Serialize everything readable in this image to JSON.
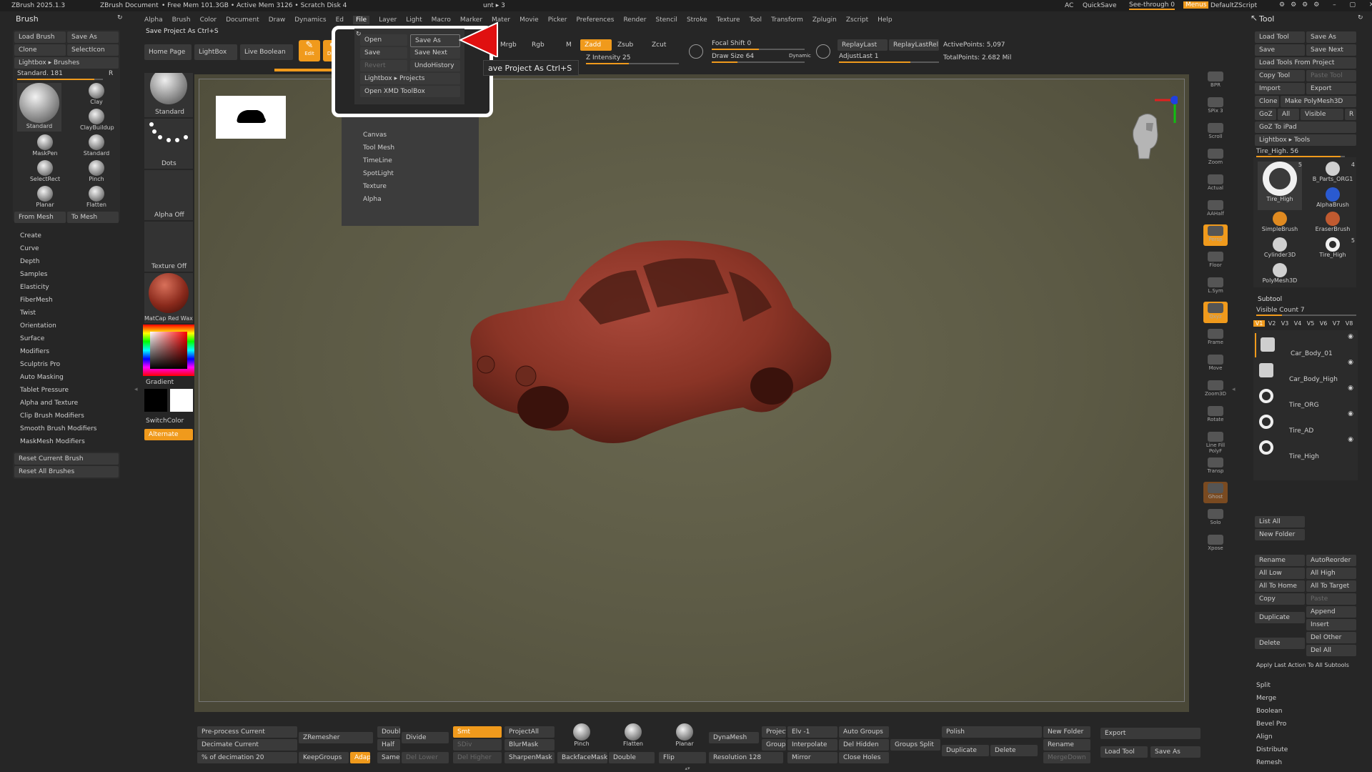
{
  "titlebar": {
    "app": "ZBrush 2025.1.3",
    "doc": "ZBrush Document",
    "mem": "• Free Mem 101.3GB • Active Mem 3126 • Scratch Disk 4",
    "tail": "unt ▸ 3",
    "ac": "AC",
    "quicksave": "QuickSave",
    "seethrough": "See-through 0",
    "menus": "Menus",
    "script": "DefaultZScript"
  },
  "menubar": [
    "Alpha",
    "Brush",
    "Color",
    "Document",
    "Draw",
    "Dynamics",
    "Ed",
    "File",
    "Layer",
    "Light",
    "Macro",
    "Marker",
    "Mater",
    "Movie",
    "Picker",
    "Preferences",
    "Render",
    "Stencil",
    "Stroke",
    "Texture",
    "Tool",
    "Transform",
    "Zplugin",
    "Zscript",
    "Help"
  ],
  "file_menu": {
    "open": "Open",
    "save_as": "Save As",
    "save": "Save",
    "save_next": "Save Next",
    "revert": "Revert",
    "undo_history": "UndoHistory",
    "lightbox_projects": "Lightbox ▸ Projects",
    "open_xmd": "Open XMD ToolBox",
    "sub": [
      "Canvas",
      "Tool Mesh",
      "TimeLine",
      "SpotLight",
      "Texture",
      "Alpha"
    ]
  },
  "tooltip": "ave Project As  Ctrl+S",
  "hint": "Save Project As Ctrl+S",
  "brush_palette": {
    "title": "Brush",
    "load": "Load Brush",
    "saveas": "Save As",
    "clone": "Clone",
    "selecticon": "SelectIcon",
    "lightbox": "Lightbox ▸ Brushes",
    "standard_val": "Standard. 181",
    "r": "R",
    "brushes": [
      {
        "label": "Standard"
      },
      {
        "label": "Clay"
      },
      {
        "label": "ClayBuildup"
      },
      {
        "label": "MaskPen"
      },
      {
        "label": "Standard"
      },
      {
        "label": "SelectRect"
      },
      {
        "label": "Pinch"
      },
      {
        "label": "Planar"
      },
      {
        "label": "Flatten"
      }
    ],
    "from_mesh": "From Mesh",
    "to_mesh": "To Mesh",
    "sections": [
      "Create",
      "Curve",
      "Depth",
      "Samples",
      "Elasticity",
      "FiberMesh",
      "Twist",
      "Orientation",
      "Surface",
      "Modifiers",
      "Sculptris Pro",
      "Auto Masking",
      "Tablet Pressure",
      "Alpha and Texture",
      "Clip Brush Modifiers",
      "Smooth Brush Modifiers",
      "MaskMesh Modifiers"
    ],
    "reset_current": "Reset Current Brush",
    "reset_all": "Reset All Brushes"
  },
  "left_shelf": {
    "standard": "Standard",
    "dots": "Dots",
    "alpha_off": "Alpha Off",
    "texture_off": "Texture Off",
    "matcap": "MatCap Red Wax",
    "gradient": "Gradient",
    "switchcolor": "SwitchColor",
    "alternate": "Alternate"
  },
  "top_shelf": {
    "home": "Home Page",
    "lightbox": "LightBox",
    "live_boolean": "Live Boolean",
    "edit": "Edit",
    "draw": "Draw",
    "mrgb": "Mrgb",
    "rgb": "Rgb",
    "m": "M",
    "zadd": "Zadd",
    "zsub": "Zsub",
    "zcut": "Zcut",
    "z_intensity": "Z Intensity 25",
    "focal_shift": "Focal Shift 0",
    "draw_size": "Draw Size 64",
    "dynamic": "Dynamic",
    "replaylast": "ReplayLast",
    "replaylastrel": "ReplayLastRel",
    "adjustlast": "AdjustLast 1",
    "active_points": "ActivePoints: 5,097",
    "total_points": "TotalPoints: 2.682 Mil"
  },
  "right_tools": {
    "title": "Tool",
    "load_tool": "Load Tool",
    "save_as": "Save As",
    "save": "Save",
    "save_next": "Save Next",
    "load_from_project": "Load Tools From Project",
    "copy_tool": "Copy Tool",
    "paste_tool": "Paste Tool",
    "import": "Import",
    "export": "Export",
    "clone": "Clone",
    "make_polymesh": "Make PolyMesh3D",
    "goz": "GoZ",
    "all": "All",
    "visible": "Visible",
    "r": "R",
    "goz_ipad": "GoZ To iPad",
    "lightbox_tools": "Lightbox ▸ Tools",
    "tire_high": "Tire_High. 56",
    "thumbs": [
      {
        "label": "Tire_High",
        "count": "5"
      },
      {
        "label": "B_Parts_ORG1",
        "count": "4"
      },
      {
        "label": "AlphaBrush",
        "count": ""
      },
      {
        "label": "SimpleBrush",
        "count": ""
      },
      {
        "label": "EraserBrush",
        "count": ""
      },
      {
        "label": "Cylinder3D",
        "count": ""
      },
      {
        "label": "Tire_High",
        "count": "5"
      },
      {
        "label": "PolyMesh3D",
        "count": ""
      }
    ],
    "subtool": "Subtool",
    "visible_count": "Visible Count 7",
    "vtabs": [
      "V1",
      "V2",
      "V3",
      "V4",
      "V5",
      "V6",
      "V7",
      "V8"
    ],
    "subtools": [
      "Car_Body_01",
      "Car_Body_High",
      "Tire_ORG",
      "Tire_AD",
      "Tire_High"
    ],
    "list_all": "List All",
    "new_folder": "New Folder",
    "rename": "Rename",
    "autoreorder": "AutoReorder",
    "all_low": "All Low",
    "all_high": "All High",
    "all_to_home": "All To Home",
    "all_to_target": "All To Target",
    "copy": "Copy",
    "paste": "Paste",
    "duplicate": "Duplicate",
    "append": "Append",
    "insert": "Insert",
    "delete": "Delete",
    "del_other": "Del Other",
    "del_all": "Del All",
    "apply_last": "Apply Last Action To All Subtools",
    "split": "Split",
    "merge": "Merge",
    "boolean": "Boolean",
    "bevel_pro": "Bevel Pro",
    "align": "Align",
    "distribute": "Distribute",
    "remesh": "Remesh"
  },
  "right_shelf": [
    "BPR",
    "SPix 3",
    "Scroll",
    "Zoom",
    "Actual",
    "AAHalf",
    "Persp",
    "Floor",
    "L.Sym",
    "Qxyz",
    "Frame",
    "Move",
    "Zoom3D",
    "Rotate",
    "Line Fill PolyF",
    "Transp",
    "Ghost",
    "Solo",
    "Xpose"
  ],
  "bottom": {
    "preprocess": "Pre-process Current",
    "decimate": "Decimate Current",
    "pct_decimation": "% of decimation 20",
    "zremesher": "ZRemesher",
    "keepgroups": "KeepGroups",
    "double": "Double",
    "half": "Half",
    "adapt": "Adapt",
    "same": "Same",
    "divide": "Divide",
    "del_lower": "Del Lower",
    "smt": "Smt",
    "sdiv": "SDiv",
    "del_higher": "Del Higher",
    "projectall": "ProjectAll",
    "blurmask": "BlurMask",
    "sharpenmask": "SharpenMask",
    "pinch": "Pinch",
    "flatten": "Flatten",
    "planar": "Planar",
    "backfacemask": "BackfaceMask",
    "double2": "Double",
    "flip": "Flip",
    "dynamesh": "DynaMesh",
    "resolution": "Resolution 128",
    "project": "Project",
    "groups": "Groups",
    "elv": "Elv -1",
    "interpolate": "Interpolate",
    "mirror": "Mirror",
    "auto_groups": "Auto Groups",
    "del_hidden": "Del Hidden",
    "close_holes": "Close Holes",
    "groups_split": "Groups Split",
    "polish": "Polish",
    "duplicate": "Duplicate",
    "delete": "Delete",
    "new_folder": "New Folder",
    "rename": "Rename",
    "mergedown": "MergeDown",
    "export": "Export",
    "load_tool": "Load Tool",
    "save_as": "Save As"
  },
  "colors": {
    "accent": "#f09a1c",
    "highlight_box": "#ffffff",
    "arrow": "#e01010",
    "canvas": "#5c5a45",
    "car": "#8a3426"
  }
}
